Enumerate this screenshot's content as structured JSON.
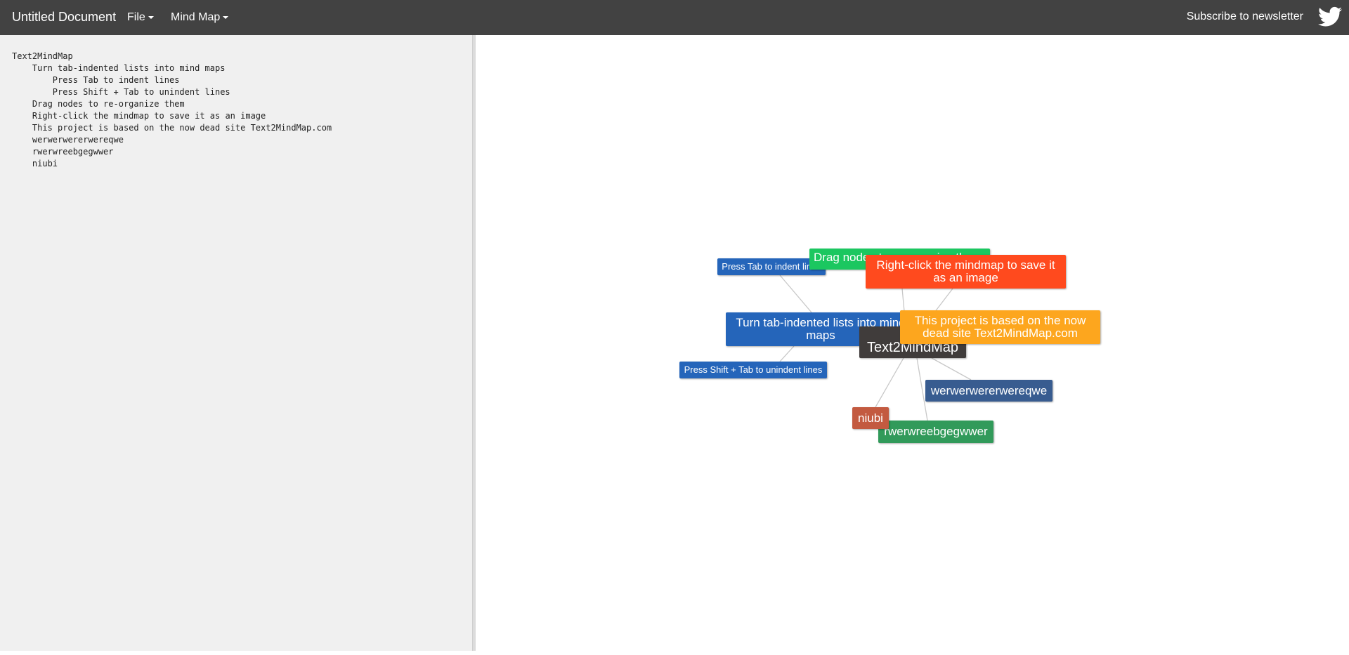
{
  "navbar": {
    "title": "Untitled Document",
    "menus": [
      {
        "label": "File"
      },
      {
        "label": "Mind Map"
      }
    ],
    "subscribe_label": "Subscribe to newsletter",
    "social_icon": "twitter-icon"
  },
  "editor": {
    "text": "Text2MindMap\n\tTurn tab-indented lists into mind maps\n\t\tPress Tab to indent lines\n\t\tPress Shift + Tab to unindent lines\n\tDrag nodes to re-organize them\n\tRight-click the mindmap to save it as an image\n\tThis project is based on the now dead site Text2MindMap.com\n\twerwerwererwereqwe\n\trwerwreebgegwwer\n\tniubi"
  },
  "mindmap": {
    "root": {
      "label": "Text2MindMap",
      "color": "#403c3b"
    },
    "nodes": [
      {
        "id": "press-tab",
        "label": "Press Tab to indent lines",
        "color": "#2565ba"
      },
      {
        "id": "drag-nodes",
        "label": "Drag nodes to re-organize them",
        "color": "#1bc760"
      },
      {
        "id": "turn-tab",
        "label": "Turn tab-indented lists into mind maps",
        "color": "#2565ba"
      },
      {
        "id": "press-shift",
        "label": "Press Shift + Tab to unindent lines",
        "color": "#2565ba"
      },
      {
        "id": "root",
        "label": "Text2MindMap",
        "color": "#403c3b"
      },
      {
        "id": "right-click",
        "label": "Right-click the mindmap to save it as an image",
        "color": "#ff4a1e"
      },
      {
        "id": "project",
        "label": "This project is based on the now dead site Text2MindMap.com",
        "color": "#fda61e"
      },
      {
        "id": "werwer",
        "label": "werwerwererwereqwe",
        "color": "#385c90"
      },
      {
        "id": "rwerw",
        "label": "rwerwreebgegwwer",
        "color": "#319a5a"
      },
      {
        "id": "niubi",
        "label": "niubi",
        "color": "#c35a40"
      }
    ],
    "link_color": "#c8c8c8"
  }
}
